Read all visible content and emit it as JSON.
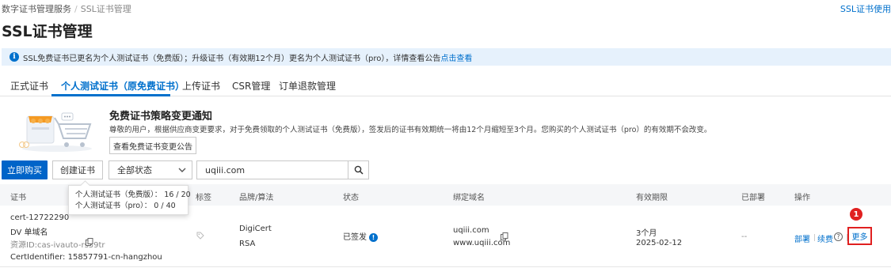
{
  "breadcrumb": {
    "root": "数字证书管理服务",
    "current": "SSL证书管理"
  },
  "top_link": "SSL证书使用",
  "page_title": "SSL证书管理",
  "notice": {
    "text": "SSL免费证书已更名为个人测试证书（免费版）；升级证书（有效期12个月）更名为个人测试证书（pro），详情查看公告",
    "link": "点击查看"
  },
  "tabs": [
    "正式证书",
    "个人测试证书（原免费证书）",
    "上传证书",
    "CSR管理",
    "订单退款管理"
  ],
  "active_tab": 1,
  "banner": {
    "title": "免费证书策略变更通知",
    "desc": "尊敬的用户，根据供应商变更要求，对于免费领取的个人测试证书（免费版），签发后的证书有效期统一将由12个月缩短至3个月。您购买的个人测试证书（pro）的有效期不会改变。",
    "button": "查看免费证书变更公告"
  },
  "toolbar": {
    "buy": "立即购买",
    "create": "创建证书",
    "status_select": "全部状态",
    "search_value": "uqiii.com"
  },
  "tooltip": {
    "line1": "个人测试证书（免费版）： 16 / 20",
    "line2": "个人测试证书（pro）： 0 / 40"
  },
  "table": {
    "headers": {
      "cert": "证书",
      "tag": "标签",
      "brand": "品牌/算法",
      "status": "状态",
      "domain": "绑定域名",
      "validity": "有效期限",
      "deployed": "已部署",
      "actions": "操作"
    },
    "row": {
      "cert_name": "cert-12722290",
      "cert_type": "DV 单域名",
      "resource_id": "资源ID:cas-ivauto-rs39tr",
      "cert_identifier": "CertIdentifier: 15857791-cn-hangzhou",
      "brand": "DigiCert",
      "algorithm": "RSA",
      "status": "已签发",
      "domain1": "uqiii.com",
      "domain2": "www.uqiii.com",
      "validity": "3个月",
      "expiry": "2025-02-12",
      "deployed": "--",
      "action_deploy": "部署",
      "action_renew": "续费",
      "action_more": "更多"
    }
  },
  "step_marker": "1",
  "colors": {
    "accent": "#0070cc",
    "primary_button": "#0064c8",
    "highlight": "#e02020",
    "notice_bg": "#e6f1fc"
  }
}
